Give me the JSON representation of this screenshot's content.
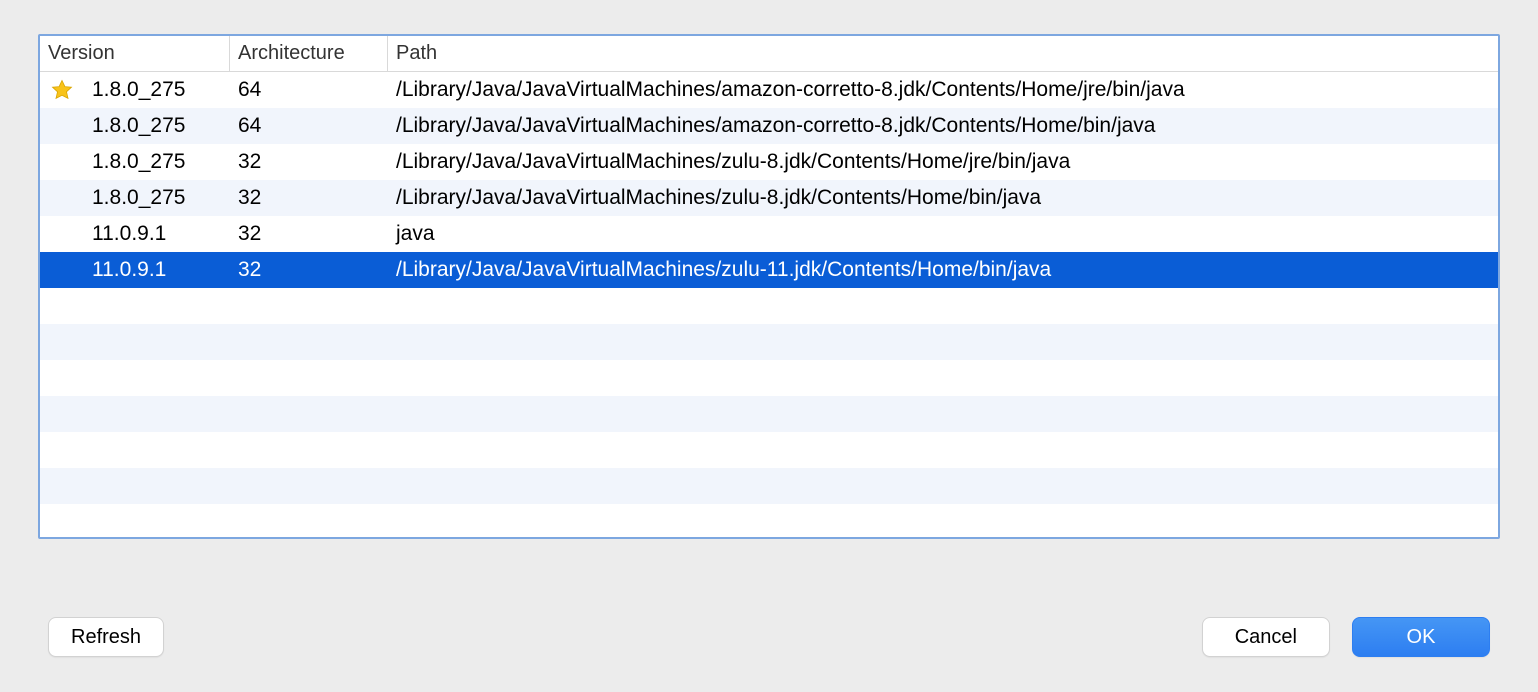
{
  "columns": {
    "version": "Version",
    "architecture": "Architecture",
    "path": "Path"
  },
  "rows": [
    {
      "starred": true,
      "selected": false,
      "version": "1.8.0_275",
      "architecture": "64",
      "path": "/Library/Java/JavaVirtualMachines/amazon-corretto-8.jdk/Contents/Home/jre/bin/java"
    },
    {
      "starred": false,
      "selected": false,
      "version": "1.8.0_275",
      "architecture": "64",
      "path": "/Library/Java/JavaVirtualMachines/amazon-corretto-8.jdk/Contents/Home/bin/java"
    },
    {
      "starred": false,
      "selected": false,
      "version": "1.8.0_275",
      "architecture": "32",
      "path": "/Library/Java/JavaVirtualMachines/zulu-8.jdk/Contents/Home/jre/bin/java"
    },
    {
      "starred": false,
      "selected": false,
      "version": "1.8.0_275",
      "architecture": "32",
      "path": "/Library/Java/JavaVirtualMachines/zulu-8.jdk/Contents/Home/bin/java"
    },
    {
      "starred": false,
      "selected": false,
      "version": "11.0.9.1",
      "architecture": "32",
      "path": "java"
    },
    {
      "starred": false,
      "selected": true,
      "version": "11.0.9.1",
      "architecture": "32",
      "path": "/Library/Java/JavaVirtualMachines/zulu-11.jdk/Contents/Home/bin/java"
    }
  ],
  "buttons": {
    "refresh": "Refresh",
    "cancel": "Cancel",
    "ok": "OK"
  }
}
